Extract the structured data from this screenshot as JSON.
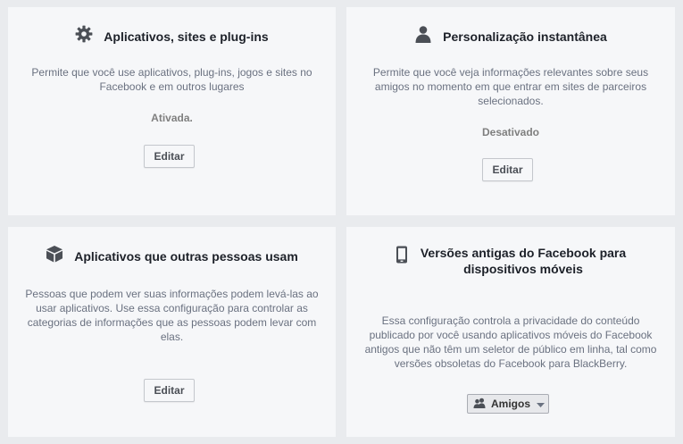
{
  "cards": [
    {
      "title": "Aplicativos, sites e plug-ins",
      "icon": "gear-icon",
      "description": "Permite que você use aplicativos, plug-ins, jogos e sites no Facebook e em outros lugares",
      "status": "Ativada.",
      "button_label": "Editar"
    },
    {
      "title": "Personalização instantânea",
      "icon": "person-icon",
      "description": "Permite que você veja informações relevantes sobre seus amigos no momento em que entrar em sites de parceiros selecionados.",
      "status": "Desativado",
      "button_label": "Editar"
    },
    {
      "title": "Aplicativos que outras pessoas usam",
      "icon": "cube-icon",
      "description": "Pessoas que podem ver suas informações podem levá-las ao usar aplicativos. Use essa configuração para controlar as categorias de informações que as pessoas podem levar com elas.",
      "button_label": "Editar"
    },
    {
      "title_line1": "Versões antigas do Facebook para",
      "title_line2": "dispositivos móveis",
      "icon": "mobile-phone-icon",
      "description": "Essa configuração controla a privacidade do conteúdo publicado por você usando aplicativos móveis do Facebook antigos que não têm um seletor de público em linha, tal como versões obsoletas do Facebook para BlackBerry.",
      "audience": {
        "label": "Amigos",
        "icon": "friends-icon"
      }
    }
  ]
}
